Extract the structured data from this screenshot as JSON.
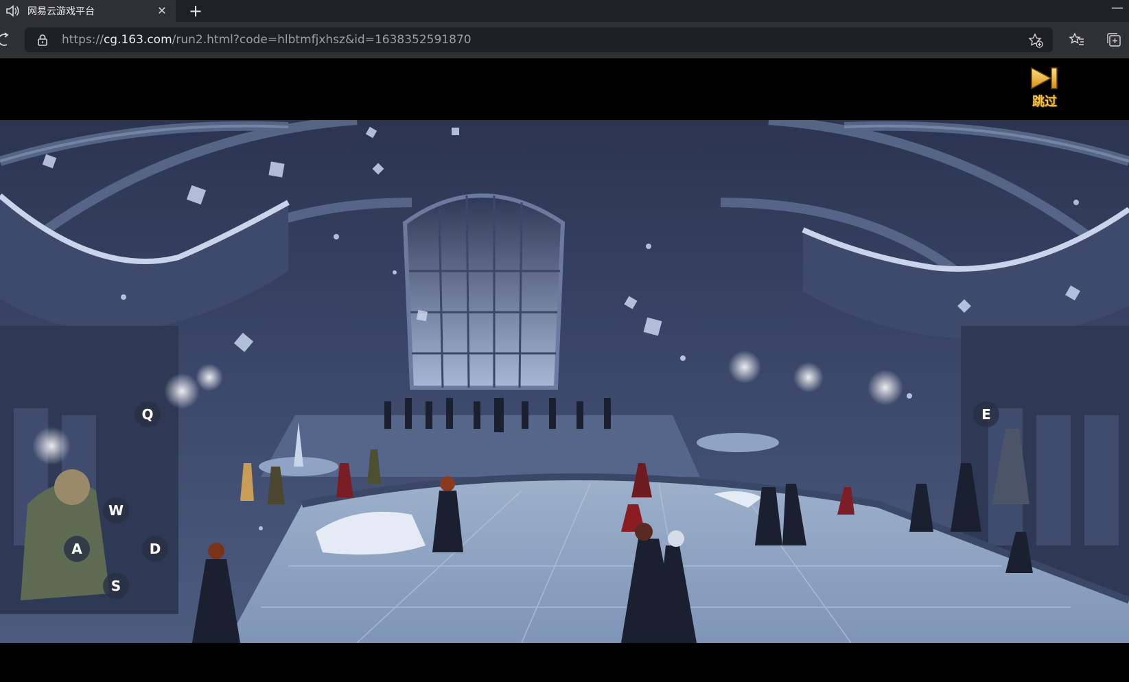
{
  "tab": {
    "title": "网易云游戏平台",
    "close_icon": "close-icon",
    "audio_icon": "speaker-icon"
  },
  "new_tab_symbol": "+",
  "window": {
    "minimize_symbol": "—"
  },
  "address_bar": {
    "url_prefix": "https://",
    "url_host": "cg.163.com",
    "url_path": "/run2.html?code=hlbtmfjxhsz&id=1638352591870"
  },
  "game": {
    "skip_label": "跳过",
    "skip_icon": "skip-forward-icon",
    "keys": {
      "q": "Q",
      "w": "W",
      "a": "A",
      "s": "S",
      "d": "D",
      "e": "E"
    }
  },
  "colors": {
    "tab_bar": "#202124",
    "toolbar": "#2f3033",
    "skip_gold": "#f2c24a"
  }
}
